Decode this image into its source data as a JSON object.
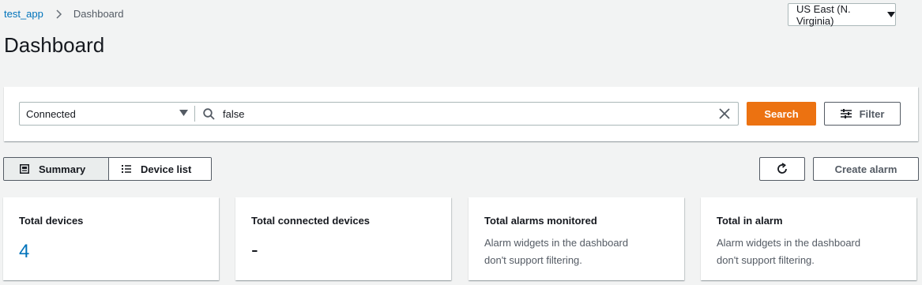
{
  "breadcrumb": {
    "app": "test_app",
    "current": "Dashboard"
  },
  "page": {
    "title": "Dashboard"
  },
  "region": {
    "label": "US East (N. Virginia)"
  },
  "filter": {
    "property": "Connected",
    "value": "false",
    "search_label": "Search",
    "filter_label": "Filter"
  },
  "views": {
    "summary_label": "Summary",
    "device_list_label": "Device list"
  },
  "toolbar": {
    "create_alarm_label": "Create alarm"
  },
  "cards": [
    {
      "title": "Total devices",
      "value": "4"
    },
    {
      "title": "Total connected devices",
      "value": "-"
    },
    {
      "title": "Total alarms monitored",
      "note_line1": "Alarm widgets in the dashboard",
      "note_line2": "don't support filtering."
    },
    {
      "title": "Total in alarm",
      "note_line1": "Alarm widgets in the dashboard",
      "note_line2": "don't support filtering."
    }
  ],
  "colors": {
    "accent": "#ec7211",
    "link": "#0073bb",
    "background": "#f2f3f3"
  }
}
